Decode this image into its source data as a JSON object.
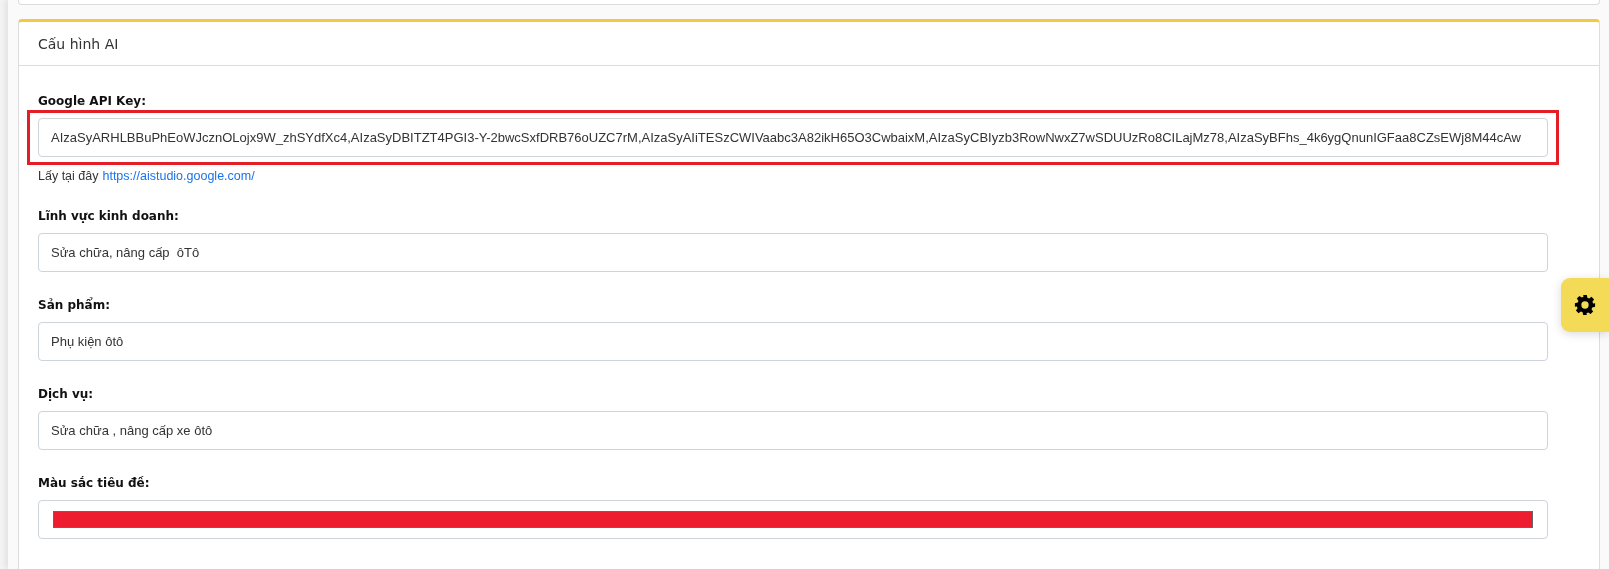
{
  "card": {
    "title": "Cấu hình AI"
  },
  "fields": [
    {
      "kind": "text",
      "label": "Google API Key:",
      "value": "AIzaSyARHLBBuPhEoWJcznOLojx9W_zhSYdfXc4,AIzaSyDBITZT4PGI3-Y-2bwcSxfDRB76oUZC7rM,AIzaSyAIiTESzCWIVaabc3A82ikH65O3CwbaixM,AIzaSyCBIyzb3RowNwxZ7wSDUUzRo8CILajMz78,AIzaSyBFhs_4k6ygQnunIGFaa8CZsEWj8M44cAw",
      "highlighted": true,
      "help": {
        "text": "Lấy tại đây",
        "link": "https://aistudio.google.com/"
      }
    },
    {
      "kind": "text",
      "label": "Lĩnh vực kinh doanh:",
      "value": "Sửa chữa, nâng cấp  ôTô",
      "highlighted": false
    },
    {
      "kind": "text",
      "label": "Sản phẩm:",
      "value": "Phụ kiện ôtô",
      "highlighted": false
    },
    {
      "kind": "text",
      "label": "Dịch vụ:",
      "value": "Sửa chữa , nâng cấp xe ôtô",
      "highlighted": false
    },
    {
      "kind": "color",
      "label": "Màu sắc tiêu đề:",
      "color": "#ed1c2e",
      "highlighted": false
    }
  ]
}
